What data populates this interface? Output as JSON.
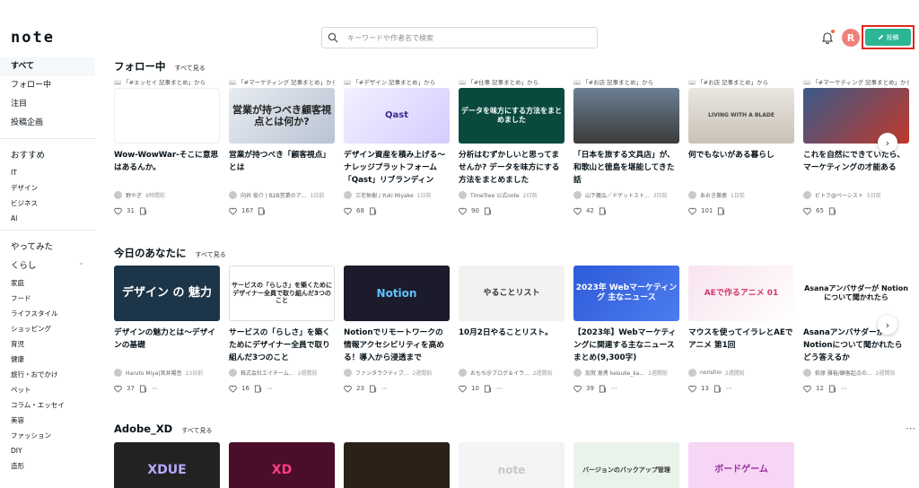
{
  "header": {
    "logo": "note",
    "search_placeholder": "キーワードや作者名で検索",
    "avatar_letter": "R",
    "post_label": "投稿"
  },
  "sidebar": {
    "top_items": [
      "すべて",
      "フォロー中",
      "注目",
      "投稿企画"
    ],
    "recommend_head": "おすすめ",
    "recommend_items": [
      "IT",
      "デザイン",
      "ビジネス",
      "AI"
    ],
    "tried_head": "やってみた",
    "life_head": "くらし",
    "life_items": [
      "家庭",
      "フード",
      "ライフスタイル",
      "ショッピング",
      "育児",
      "健康",
      "旅行・おでかけ",
      "ペット",
      "コラム・エッセイ",
      "美容",
      "ファッション",
      "DIY",
      "造形"
    ]
  },
  "sections": [
    {
      "title": "フォロー中",
      "more": "すべて見る",
      "cards": [
        {
          "from": "「#エッセイ 記事まとめ」から",
          "thumb_text": "",
          "title": "Wow-WowWar-そこに意思はあるんか。",
          "author": "野やぎ",
          "time": "8時間前",
          "likes": "31"
        },
        {
          "from": "「#マーケティング 記事まとめ」から",
          "thumb_text": "営業が持つべき顧客視点とは何か?",
          "title": "営業が持つべき「顧客視点」とは",
          "author": "向井 俊介 | B2B営業のア...",
          "time": "1日前",
          "likes": "167"
        },
        {
          "from": "「#デザイン 記事まとめ」から",
          "thumb_text": "Qast",
          "title": "デザイン資産を積み上げる〜ナレッジプラットフォーム「Qast」リブランディング...",
          "author": "三宅佑樹 / Yuki Miyake",
          "time": "1日前",
          "likes": "68"
        },
        {
          "from": "「#仕事 記事まとめ」から",
          "thumb_text": "データを味方にする方法をまとめました",
          "title": "分析はむずかしいと思ってませんか? データを味方にする方法をまとめました",
          "author": "TimeTree 公式note",
          "time": "2日前",
          "likes": "90"
        },
        {
          "from": "「#お店 記事まとめ」から",
          "thumb_text": "",
          "title": "「日本を旅する文具店」が、和歌山と徳島を堪能してきた話",
          "author": "山下義弘／ドゲットスト...",
          "time": "3日前",
          "likes": "42"
        },
        {
          "from": "「#お店 記事まとめ」から",
          "thumb_text": "LIVING WITH A BLADE",
          "title": "何でもないがある暮らし",
          "author": "あおき巣鹿",
          "time": "1日前",
          "likes": "101"
        },
        {
          "from": "「#マーケティング 記事まとめ」から",
          "thumb_text": "",
          "title": "これを自然にできていたら、マーケティングの才能ある",
          "author": "ピトク@ペーシスト",
          "time": "5日前",
          "likes": "65"
        }
      ]
    },
    {
      "title": "今日のあなたに",
      "more": "すべて見る",
      "cards": [
        {
          "thumb_text": "デザイン の 魅力",
          "title": "デザインの魅力とは〜デザインの基礎",
          "author": "Haruto Miya|宮井陽音",
          "time": "13日前",
          "likes": "37"
        },
        {
          "thumb_text": "サービスの「らしさ」を築くためにデザイナー全員で取り組んだ3つのこと",
          "title": "サービスの「らしさ」を築くためにデザイナー全員で取り組んだ3つのこと",
          "author": "株式会社エイチーム...",
          "time": "2週間前",
          "likes": "16"
        },
        {
          "thumb_text": "Notion",
          "title": "Notionでリモートワークの情報アクセシビリティを高める！導入から浸透まで",
          "author": "ファンタラクティブ...",
          "time": "2週間前",
          "likes": "23"
        },
        {
          "thumb_text": "やることリスト",
          "title": "10月2日やることリスト。",
          "author": "おもち＠ブログ＆イラ...",
          "time": "2週間前",
          "likes": "10"
        },
        {
          "thumb_text": "2023年 Webマーケティング 主なニュース",
          "title": "【2023年】Webマーケティングに関連する主なニュースまとめ(9,300字)",
          "author": "加賀 恵勇 keisuke_ka...",
          "time": "2週間前",
          "likes": "39"
        },
        {
          "thumb_text": "AEで作るアニメ 01",
          "title": "マウスを使ってイラレとAEでアニメ 第1回",
          "author": "norishio",
          "time": "2週間前",
          "likes": "13"
        },
        {
          "thumb_text": "Asanaアンバサダーが Notionについて聞かれたら",
          "title": "Asanaアンバサダーが Notionについて聞かれたらどう答えるか",
          "author": "萩原 雅裕/顧客起点の...",
          "time": "2週間前",
          "likes": "12"
        }
      ]
    },
    {
      "title": "Adobe_XD",
      "more": "すべて見る",
      "cards": [
        {
          "thumb_text": "XDUE"
        },
        {
          "thumb_text": "XD"
        },
        {
          "thumb_text": ""
        },
        {
          "thumb_text": "note"
        },
        {
          "thumb_text": "バージョンのバックアップ管理"
        },
        {
          "thumb_text": "ボードゲーム"
        },
        {
          "thumb_text": ""
        }
      ]
    }
  ],
  "colors": {
    "accent": "#2cb696",
    "highlight": "#e1261c"
  }
}
